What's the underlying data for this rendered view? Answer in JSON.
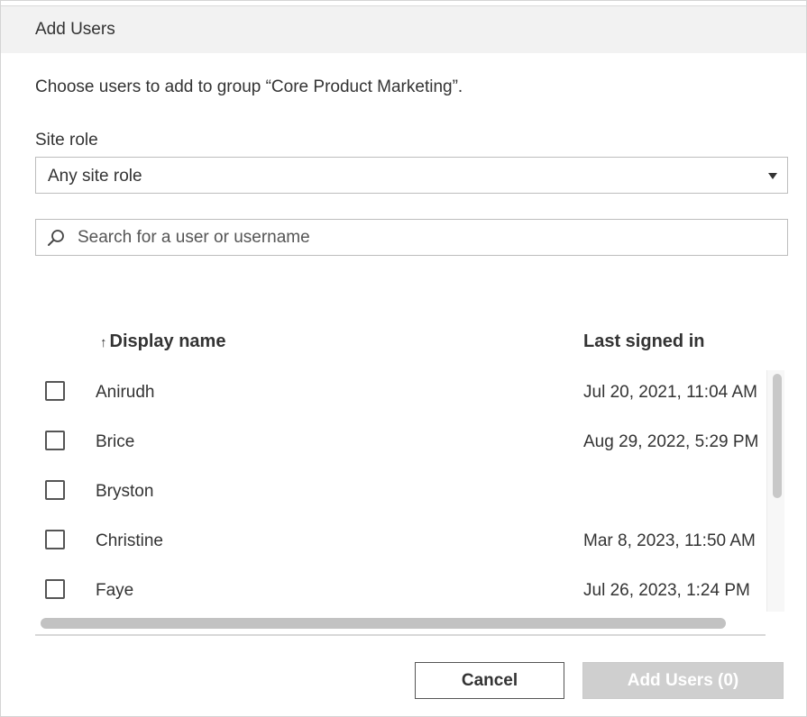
{
  "dialog": {
    "title": "Add Users",
    "instructions": "Choose users to add to group “Core Product Marketing”."
  },
  "filters": {
    "site_role_label": "Site role",
    "site_role_value": "Any site role",
    "search_placeholder": "Search for a user or username"
  },
  "table": {
    "columns": {
      "sort_indicator": "↑",
      "display_name": "Display name",
      "last_signed_in": "Last signed in"
    },
    "rows": [
      {
        "name": "Anirudh",
        "last_signed_in": "Jul 20, 2021, 11:04 AM",
        "checked": false
      },
      {
        "name": "Brice",
        "last_signed_in": "Aug 29, 2022, 5:29 PM",
        "checked": false
      },
      {
        "name": "Bryston",
        "last_signed_in": "",
        "checked": false
      },
      {
        "name": "Christine",
        "last_signed_in": "Mar 8, 2023, 11:50 AM",
        "checked": false
      },
      {
        "name": "Faye",
        "last_signed_in": "Jul 26, 2023, 1:24 PM",
        "checked": false
      }
    ]
  },
  "buttons": {
    "cancel": "Cancel",
    "add": "Add Users (0)"
  },
  "colors": {
    "title_bar_bg": "#f2f2f2",
    "disabled_button_bg": "#cfcfcf",
    "text": "#333333"
  },
  "icons": {
    "search": "search-icon",
    "dropdown": "caret-down-icon",
    "sort": "sort-ascending-icon"
  }
}
